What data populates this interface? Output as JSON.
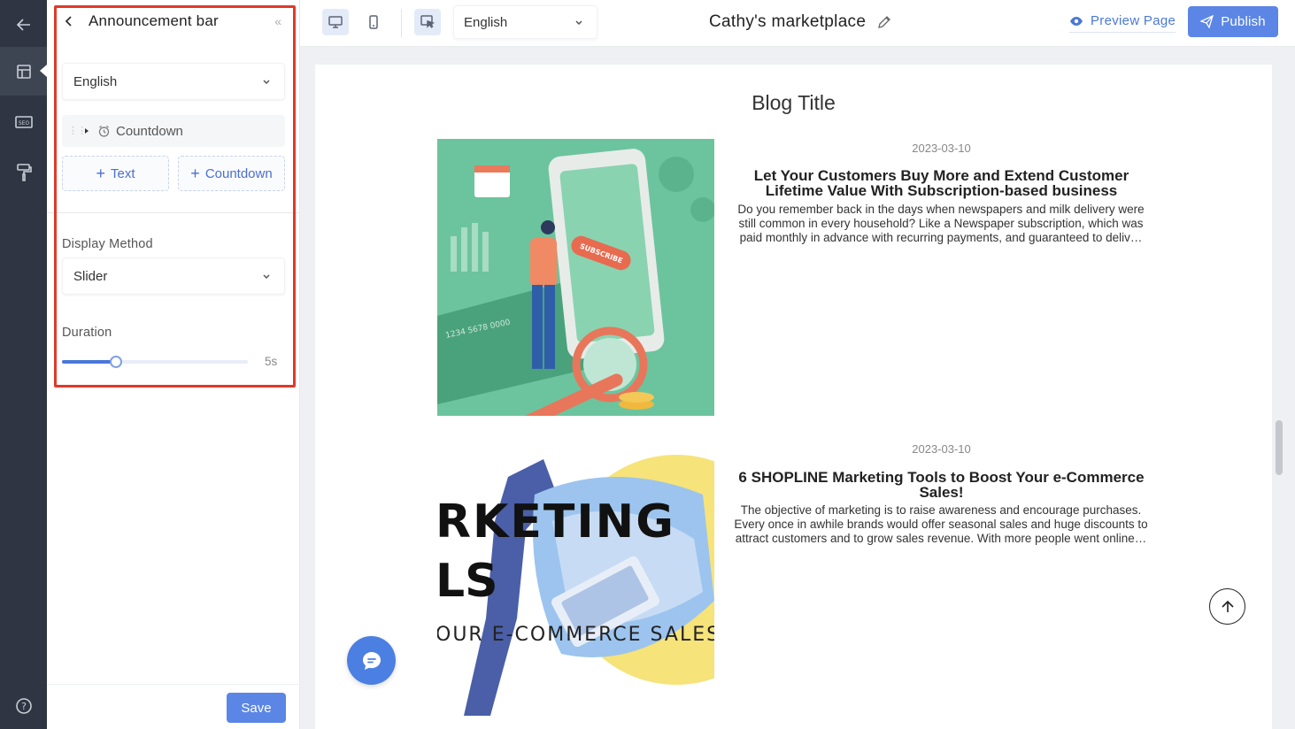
{
  "rail": {
    "items": [
      {
        "icon": "back-arrow-icon"
      },
      {
        "icon": "layout-icon"
      },
      {
        "icon": "seo-icon",
        "label": "SEO"
      },
      {
        "icon": "paint-roller-icon"
      },
      {
        "icon": "help-icon",
        "label": "?"
      }
    ]
  },
  "panel": {
    "title": "Announcement bar",
    "language": "English",
    "block_item": "Countdown",
    "add_text_label": "Text",
    "add_countdown_label": "Countdown",
    "display_method_label": "Display Method",
    "display_method_value": "Slider",
    "duration_label": "Duration",
    "duration_value": "5s",
    "duration_fraction": 0.29,
    "save_label": "Save"
  },
  "toolbar": {
    "language": "English",
    "site_title": "Cathy's marketplace",
    "preview_label": "Preview Page",
    "publish_label": "Publish",
    "accent": "#5b86e5"
  },
  "page": {
    "blog_title": "Blog Title",
    "posts": [
      {
        "date": "2023-03-10",
        "title": "Let Your Customers Buy More and Extend Customer Lifetime Value With Subscription-based business",
        "excerpt": "Do you remember back in the days when newspapers and milk delivery were still common in every household? Like a Newspaper subscription, which was paid monthly in advance with recurring payments, and guaranteed to deliv…",
        "image_badge": "SUBSCRIBE",
        "card_digits": "1234 5678 0000"
      },
      {
        "date": "2023-03-10",
        "title": "6 SHOPLINE Marketing Tools to Boost Your e-Commerce Sales!",
        "excerpt": "The objective of marketing is to raise awareness and encourage purchases. Every once in awhile brands would offer seasonal sales and huge discounts to attract customers and to grow sales revenue. With more people went online…",
        "image_line1": "RKETING",
        "image_line2": "LS",
        "image_line3": "OUR E-COMMERCE SALES"
      }
    ]
  }
}
